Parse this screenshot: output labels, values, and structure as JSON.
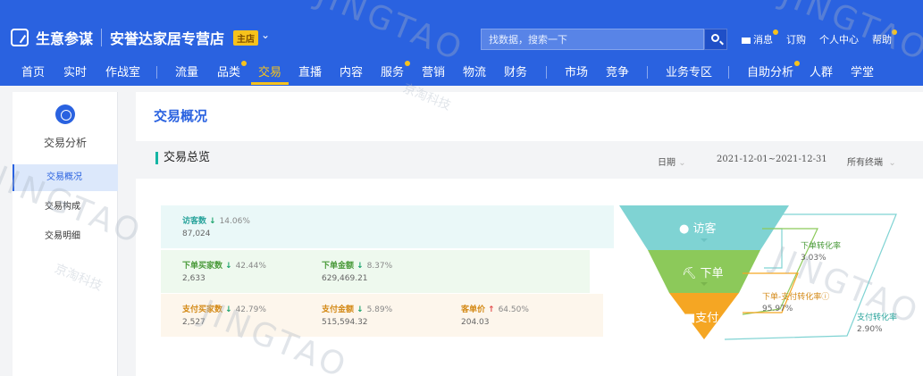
{
  "header": {
    "brand": "生意参谋",
    "store_name": "安誉达家居专营店",
    "store_badge": "主店",
    "search_placeholder": "找数据，搜索一下",
    "links": [
      "消息",
      "订购",
      "个人中心",
      "帮助"
    ]
  },
  "nav": {
    "items": [
      "首页",
      "实时",
      "作战室",
      "流量",
      "品类",
      "交易",
      "直播",
      "内容",
      "服务",
      "营销",
      "物流",
      "财务",
      "市场",
      "竞争",
      "业务专区",
      "自助分析",
      "人群",
      "学堂"
    ],
    "active": "交易"
  },
  "sidebar": {
    "title": "交易分析",
    "items": [
      "交易概况",
      "交易构成",
      "交易明细"
    ]
  },
  "main": {
    "page_title": "交易概况",
    "section_title": "交易总览",
    "date_label": "日期",
    "date_range": "2021-12-01~2021-12-31",
    "terminal": "所有终端"
  },
  "metrics": {
    "visitors": {
      "label": "访客数",
      "pct": "14.06%",
      "value": "87,024"
    },
    "order_buyers": {
      "label": "下单买家数",
      "pct": "42.44%",
      "value": "2,633"
    },
    "order_amount": {
      "label": "下单金额",
      "pct": "8.37%",
      "value": "629,469.21"
    },
    "pay_buyers": {
      "label": "支付买家数",
      "pct": "42.79%",
      "value": "2,527"
    },
    "pay_amount": {
      "label": "支付金额",
      "pct": "5.89%",
      "value": "515,594.32"
    },
    "aov": {
      "label": "客单价",
      "pct": "64.50%",
      "value": "204.03"
    }
  },
  "funnel": {
    "stages": [
      "访客",
      "下单",
      "支付"
    ],
    "colors": [
      "#7fd3d3",
      "#8cc95a",
      "#f5a623"
    ],
    "rates": [
      {
        "label": "下单转化率",
        "value": "3.03%"
      },
      {
        "label": "下单-支付转化率",
        "value": "95.97%"
      },
      {
        "label": "支付转化率",
        "value": "2.90%"
      }
    ]
  },
  "watermark": {
    "latin": "JINGTAO",
    "cn": "京淘科技"
  }
}
